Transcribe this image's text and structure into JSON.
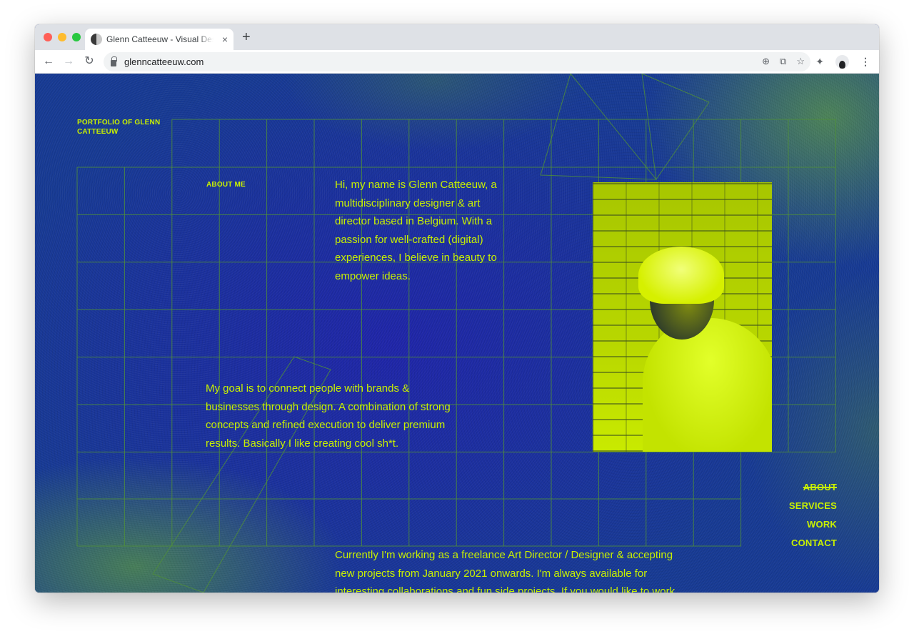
{
  "browser": {
    "tab_title": "Glenn Catteeuw - Visual Designer",
    "tab_close": "×",
    "new_tab": "+",
    "back": "←",
    "forward": "→",
    "reload": "↻",
    "url": "glenncatteeuw.com",
    "omnibox_icons": [
      "⊕",
      "⧉",
      "☆"
    ],
    "extensions_icon": "✦",
    "menu_icon": "⋮"
  },
  "site": {
    "portfolio_label": "PORTFOLIO OF GLENN CATTEEUW",
    "about_label": "ABOUT ME",
    "intro": "Hi, my name is Glenn Catteeuw, a multidisciplinary designer & art director based in Belgium. With a passion for well-crafted (digital) experiences, I believe in beauty to empower ideas.",
    "goal": "My goal is to connect people with brands & businesses through design. A combination of strong concepts and refined execution to deliver premium results. Basically I like creating cool sh*t.",
    "currently": "Currently I'm working as a freelance Art Director / Designer & accepting new projects from January 2021 onwards. I'm always available for interesting collaborations and fun side projects. If you would like to work",
    "nav": [
      {
        "label": "ABOUT",
        "active": true
      },
      {
        "label": "SERVICES",
        "active": false
      },
      {
        "label": "WORK",
        "active": false
      },
      {
        "label": "CONTACT",
        "active": false
      }
    ]
  },
  "colors": {
    "accent": "#c8f000",
    "background": "#173a93",
    "grid": "#4f8e3a"
  }
}
